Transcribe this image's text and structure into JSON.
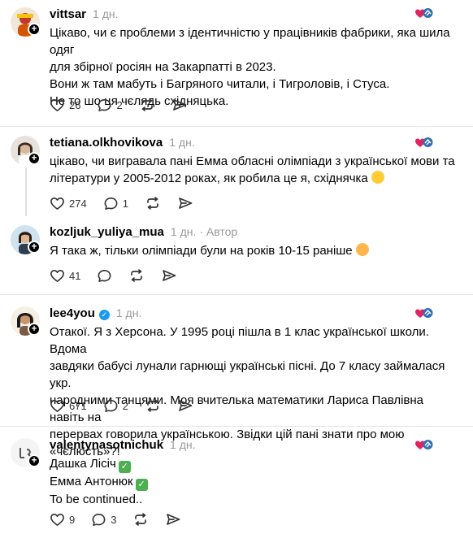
{
  "posts": [
    {
      "username": "vittsar",
      "time": "1 дн.",
      "lines": [
        "Цікаво, чи є проблеми з ідентичністю у працівників фабрики, яка шила одяг",
        "для збірної росіян на Закарпатті в 2023.",
        "Вони ж там мабуть і Багряного читали, і Тигроловів, і Стуса.",
        "Не то шо ця чєлядь східняцька."
      ],
      "likes": "26",
      "replies": "2"
    },
    {
      "username": "tetiana.olkhovikova",
      "time": "1 дн.",
      "lines": [
        "цікаво, чи вигравала пані Емма обласні олімпіади з української мови та",
        "літератури у 2005-2012 роках, як робила це я, східнячка"
      ],
      "emoji": "laughing-emoji",
      "likes": "274",
      "replies": "1"
    },
    {
      "username": "kozljuk_yuliya_mua",
      "time": "1 дн.",
      "author": "· Автор",
      "lines": [
        "Я така ж, тільки олімпіади були на років 10-15 раніше"
      ],
      "emoji": "grinning-emoji",
      "likes": "41"
    },
    {
      "username": "lee4you",
      "time": "1 дн.",
      "verified": true,
      "lines": [
        "Отакої. Я з Херсона. У 1995 році пішла в 1 клас української школи. Вдома",
        "завдяки бабусі лунали гарнющі українські пісні. До 7 класу займалася укр.",
        "народними танцями. Моя вчителька математики Лариса Павлівна навіть на",
        "перервах говорила українською. Звідки цій пані знати про мою «чєлюсть»?!"
      ],
      "likes": "671",
      "replies": "2"
    },
    {
      "username": "valentynasotnichuk",
      "time": "1 дн.",
      "lines": [
        "Дашка Лісіч",
        "Емма Антонюк",
        "To be continued.."
      ],
      "likes": "9",
      "replies": "3"
    }
  ],
  "colors": {
    "like_heart": "#e0245e",
    "check": "#4caf50",
    "verified": "#1d9bf0",
    "muted": "#999999"
  },
  "icons": [
    "heart-icon",
    "comment-icon",
    "repost-icon",
    "share-icon",
    "plus-icon",
    "reaction-icon"
  ]
}
